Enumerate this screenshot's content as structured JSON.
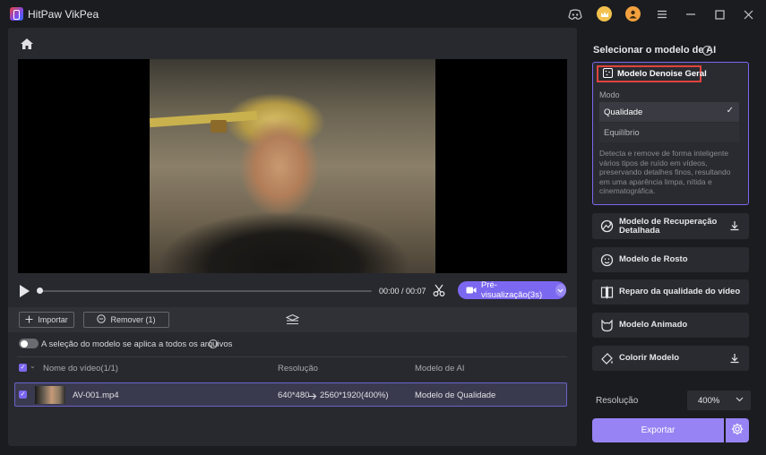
{
  "app": {
    "title": "HitPaw VikPea"
  },
  "player": {
    "time": "00:00 / 00:07",
    "preview_label": "Pré-visualização(3s)"
  },
  "toolbar": {
    "import_label": "Importar",
    "remove_label": "Remover (1)"
  },
  "apply_all": {
    "label": "A seleção do modelo se aplica a todos os arquivos",
    "enabled": false
  },
  "table": {
    "columns": [
      "Nome do vídeo(1/1)",
      "Resolução",
      "Modelo de AI"
    ],
    "rows": [
      {
        "name": "AV-001.mp4",
        "resolution_from": "640*480",
        "resolution_to": "2560*1920(400%)",
        "model": "Modelo de Qualidade"
      }
    ]
  },
  "right_panel": {
    "title": "Selecionar o modelo de AI",
    "selected_model": "Modelo Denoise Geral",
    "mode_label": "Modo",
    "modes": [
      "Qualidade",
      "Equilíbrio"
    ],
    "selected_mode": "Qualidade",
    "description": "Detecta e remove de forma inteligente vários tipos de ruído em vídeos, preservando detalhes finos, resultando em uma aparência limpa, nítida e cinematográfica.",
    "models": [
      {
        "label": "Modelo de Recuperação Detalhada",
        "icon": "detail-recovery-icon",
        "download": true
      },
      {
        "label": "Modelo de Rosto",
        "icon": "face-icon",
        "download": false
      },
      {
        "label": "Reparo da qualidade do vídeo",
        "icon": "video-repair-icon",
        "download": false
      },
      {
        "label": "Modelo Animado",
        "icon": "anime-icon",
        "download": false
      },
      {
        "label": "Colorir Modelo",
        "icon": "colorize-icon",
        "download": true
      }
    ],
    "resolution_label": "Resolução",
    "resolution_value": "400%",
    "export_label": "Exportar"
  },
  "colors": {
    "accent": "#7b68f0",
    "highlight_border": "#e0443e"
  }
}
